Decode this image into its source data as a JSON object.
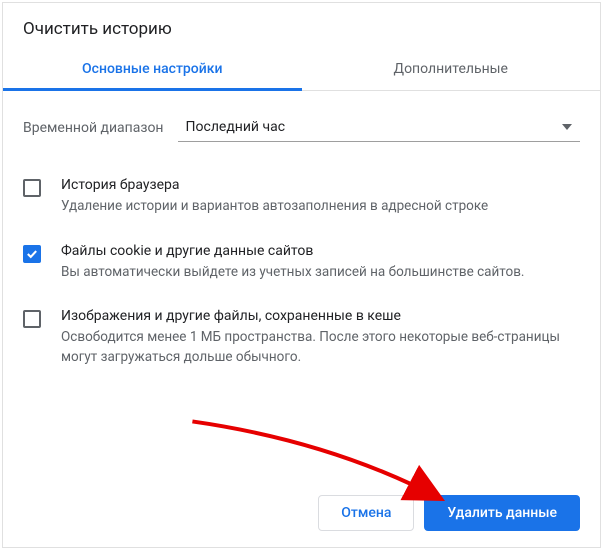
{
  "title": "Очистить историю",
  "tabs": {
    "basic": "Основные настройки",
    "advanced": "Дополнительные"
  },
  "range": {
    "label": "Временной диапазон",
    "selected": "Последний час"
  },
  "items": [
    {
      "checked": false,
      "title": "История браузера",
      "desc": "Удаление истории и вариантов автозаполнения в адресной строке"
    },
    {
      "checked": true,
      "title": "Файлы cookie и другие данные сайтов",
      "desc": "Вы автоматически выйдете из учетных записей на большинстве сайтов."
    },
    {
      "checked": false,
      "title": "Изображения и другие файлы, сохраненные в кеше",
      "desc": "Освободится менее 1 МБ пространства. После этого некоторые веб-страницы могут загружаться дольше обычного."
    }
  ],
  "actions": {
    "cancel": "Отмена",
    "confirm": "Удалить данные"
  }
}
